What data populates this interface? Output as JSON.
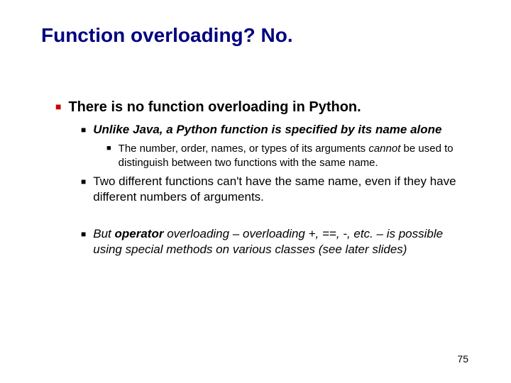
{
  "title": "Function overloading? No.",
  "l1_text": "There is no function overloading in Python.",
  "l2a_pre": "Unlike Java, a Python function is specified by its name alone",
  "l3a_pre": "The number, order, names, or types of its arguments ",
  "l3a_em": "cannot",
  "l3a_post": " be used to distinguish between two functions with the same name.",
  "l2b_text": "Two different functions can't have the same name, even if they have different numbers of arguments.",
  "l2c_pre": "But ",
  "l2c_bold": "operator",
  "l2c_post": " overloading – overloading +, ==, -, etc. – is possible using special methods on various classes (see later slides)",
  "page_number": "75"
}
